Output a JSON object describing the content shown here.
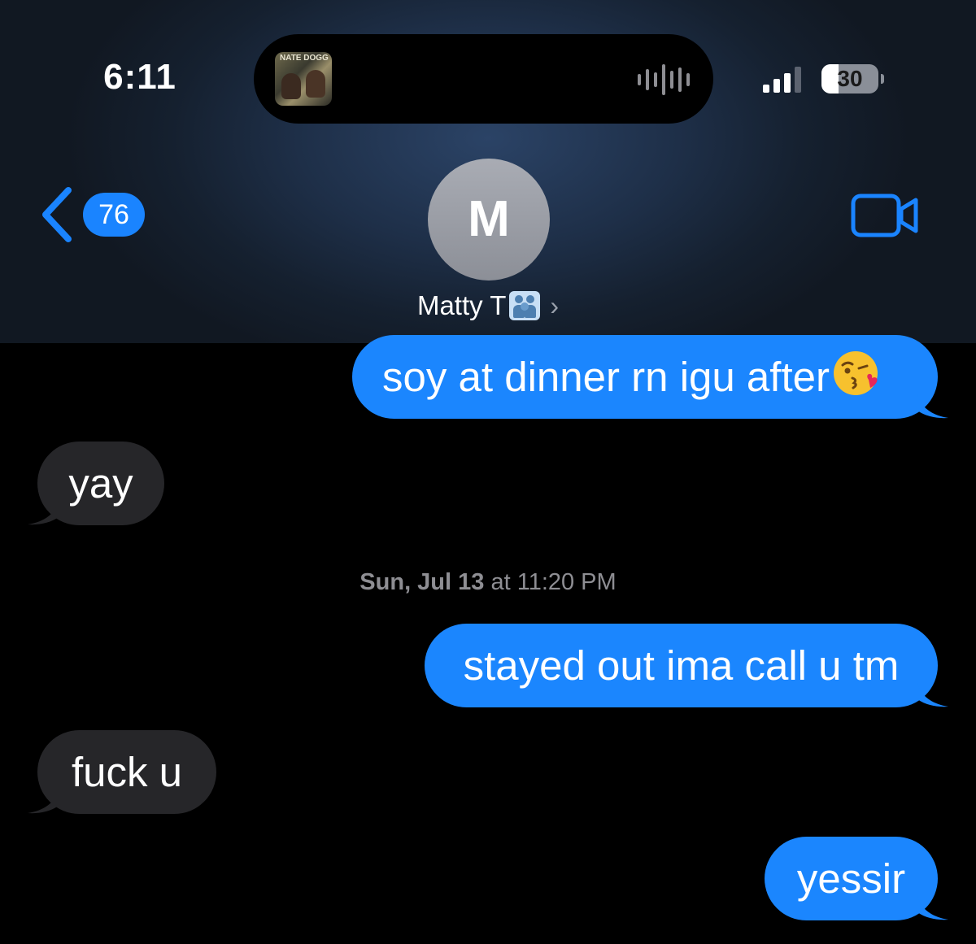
{
  "status_bar": {
    "time": "6:11",
    "now_playing_art_title": "NATE DOGG",
    "battery_level": "30",
    "battery_fraction": 0.3,
    "signal_bars_active": 3,
    "signal_bars_total": 4
  },
  "nav": {
    "unread_count": "76",
    "back_icon": "chevron-left-icon",
    "video_icon": "video-camera-icon",
    "accent_color": "#1a84ff"
  },
  "contact": {
    "avatar_initial": "M",
    "name": "Matty T",
    "name_emoji": "family-emoji",
    "chevron": "›"
  },
  "messages": [
    {
      "direction": "outgoing",
      "text": "soy at dinner rn igu after",
      "emoji": "face-blowing-a-kiss"
    },
    {
      "direction": "incoming",
      "text": "yay"
    },
    {
      "direction": "outgoing",
      "text": "stayed out ima call u tm"
    },
    {
      "direction": "incoming",
      "text": "fuck u"
    },
    {
      "direction": "outgoing",
      "text": "yessir"
    }
  ],
  "timestamp": {
    "day": "Sun, Jul 13",
    "time": "at 11:20 PM"
  },
  "colors": {
    "outgoing_bubble": "#1b86fe",
    "incoming_bubble": "#262629",
    "background": "#000000",
    "timestamp_text": "#8e8e93"
  }
}
